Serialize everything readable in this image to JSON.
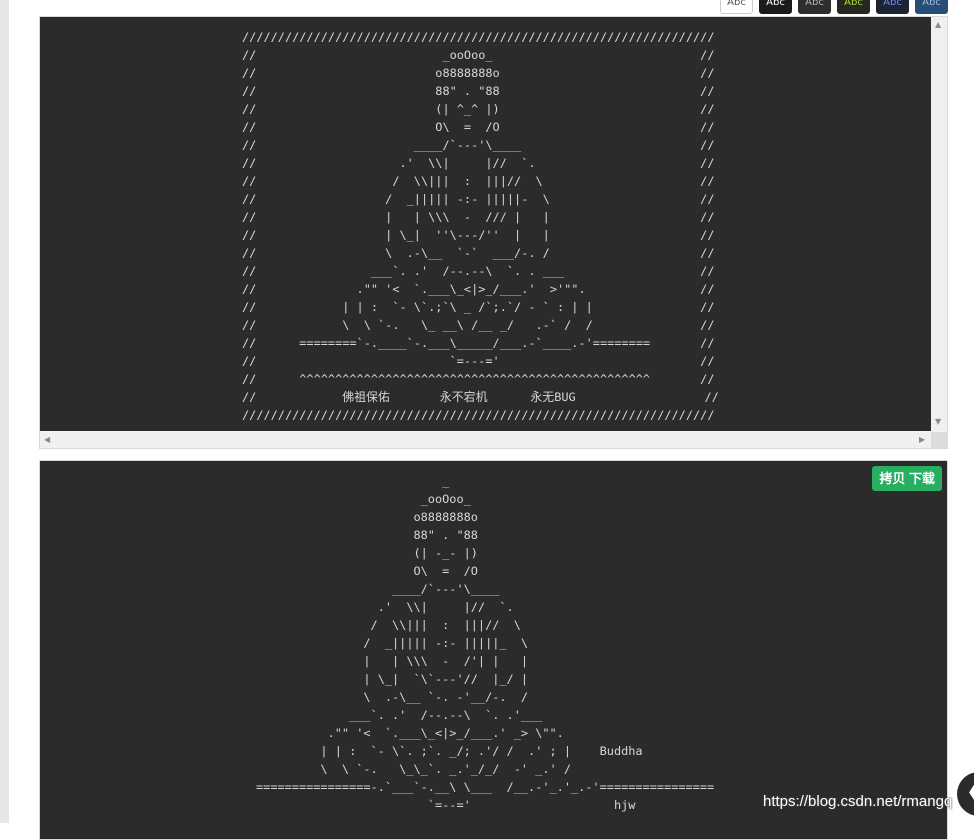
{
  "themes": [
    {
      "label": "Abc",
      "bg": "#ffffff",
      "fg": "#555555"
    },
    {
      "label": "Abc",
      "bg": "#1b1b1b",
      "fg": "#ffffff"
    },
    {
      "label": "Abc",
      "bg": "#2d2d2d",
      "fg": "#aab4c8"
    },
    {
      "label": "Abc",
      "bg": "#272822",
      "fg": "#a6e22e"
    },
    {
      "label": "Abc",
      "bg": "#1e2332",
      "fg": "#6c8cff"
    },
    {
      "label": "Abc",
      "bg": "#264f78",
      "fg": "#9fb9d6"
    }
  ],
  "block1": {
    "code": "//////////////////////////////////////////////////////////////////\n//                          _ooOoo_                             //\n//                         o8888888o                            //\n//                         88\" . \"88                            //\n//                         (| ^_^ |)                            //\n//                         O\\  =  /O                            //\n//                      ____/`---'\\____                         //\n//                    .'  \\\\|     |//  `.                       //\n//                   /  \\\\|||  :  |||//  \\                      //\n//                  /  _||||| -:- |||||-  \\                     //\n//                  |   | \\\\\\  -  /// |   |                     //\n//                  | \\_|  ''\\---/''  |   |                     //\n//                  \\  .-\\__  `-`  ___/-. /                     //\n//                ___`. .'  /--.--\\  `. . ___                   //\n//              .\"\" '<  `.___\\_<|>_/___.'  >'\"\".                //\n//            | | :  `- \\`.;`\\ _ /`;.`/ - ` : | |               //\n//            \\  \\ `-.   \\_ __\\ /__ _/   .-` /  /               //\n//      ========`-.____`-.___\\_____/___.-`____.-'========       //\n//                           `=---='                            //\n//      ^^^^^^^^^^^^^^^^^^^^^^^^^^^^^^^^^^^^^^^^^^^^^^^^^       //\n//            佛祖保佑       永不宕机      永无BUG                  //\n//////////////////////////////////////////////////////////////////"
  },
  "block2": {
    "copy_label": "拷贝 下载",
    "code": "                          _\n                       _ooOoo_\n                      o8888888o\n                      88\" . \"88\n                      (| -_- |)\n                      O\\  =  /O\n                   ____/`---'\\____\n                 .'  \\\\|     |//  `.\n                /  \\\\|||  :  |||//  \\\n               /  _||||| -:- |||||_  \\\n               |   | \\\\\\  -  /'| |   |\n               | \\_|  `\\`---'//  |_/ |\n               \\  .-\\__ `-. -'__/-.  /\n             ___`. .'  /--.--\\  `. .'___\n          .\"\" '<  `.___\\_<|>_/___.' _> \\\"\".\n         | | :  `- \\`. ;`. _/; .'/ /  .' ; |    Buddha\n         \\  \\ `-.   \\_\\_`. _.'_/_/  -' _.' /\n================-.`___`-.__\\ \\___  /__.-'_.'_.-'================\n                        `=--='                    hjw"
  },
  "watermark": "https://blog.csdn.net/rmangq"
}
